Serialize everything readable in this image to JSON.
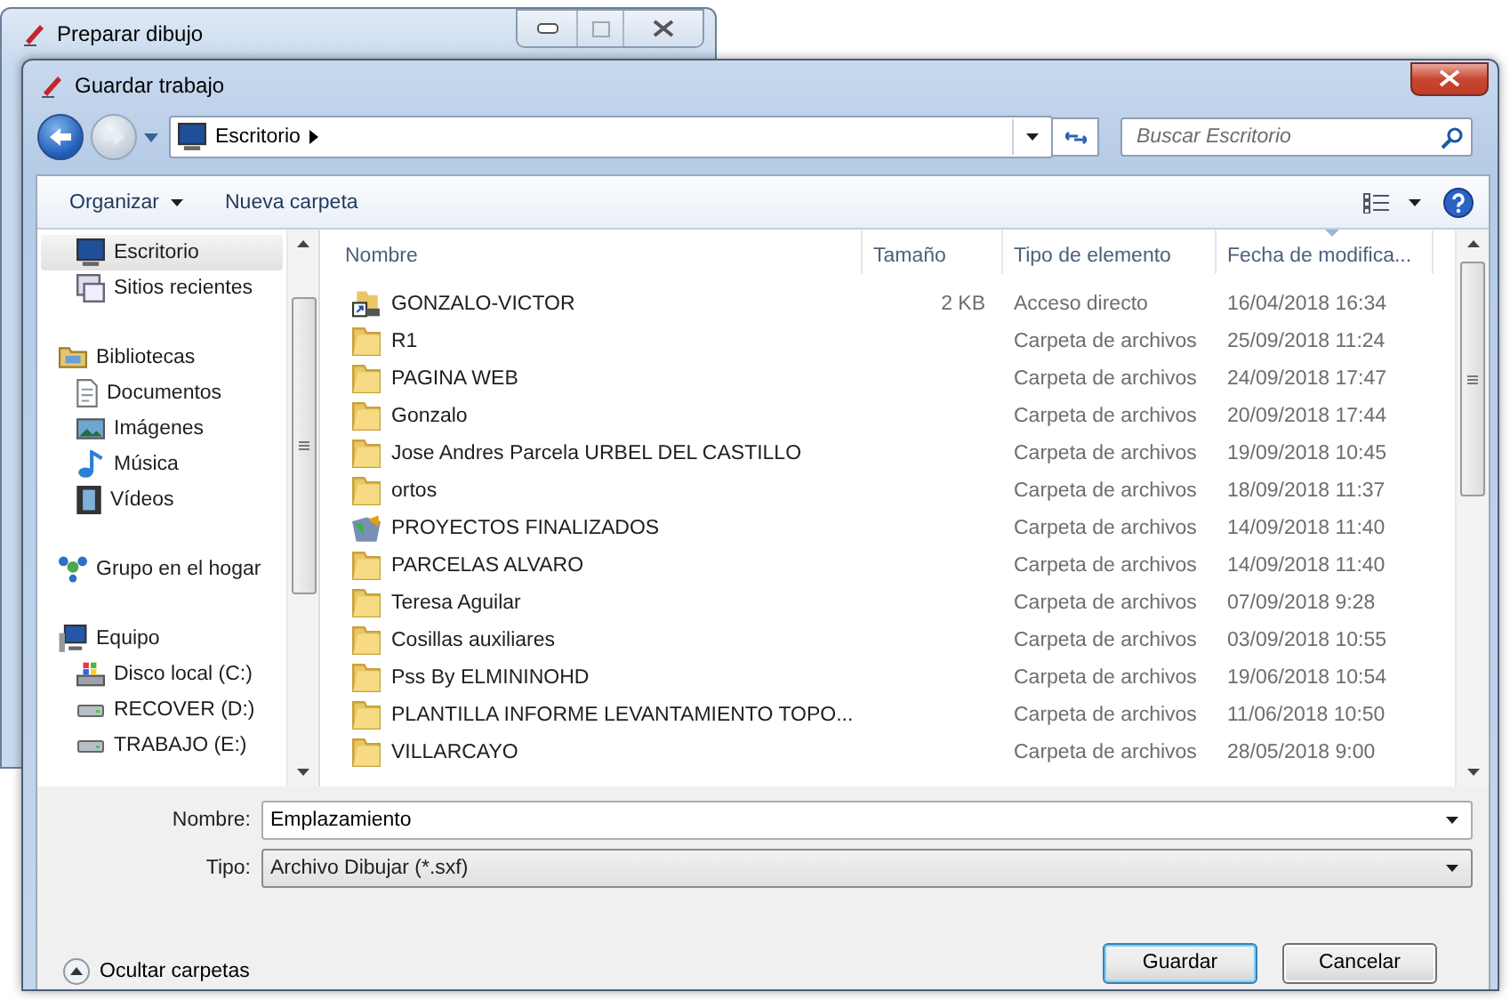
{
  "back_window": {
    "title": "Preparar dibujo"
  },
  "dialog": {
    "title": "Guardar trabajo"
  },
  "address": {
    "path": "Escritorio"
  },
  "search": {
    "placeholder": "Buscar Escritorio"
  },
  "toolbar": {
    "items": [
      {
        "label": "Organizar",
        "kind": "menu"
      },
      {
        "label": "Nueva carpeta",
        "kind": "button"
      }
    ]
  },
  "sidebar": {
    "items": [
      {
        "children": [
          {
            "label": "Escritorio",
            "kind": "desktop",
            "selected": true
          },
          {
            "label": "Sitios recientes",
            "kind": "recent",
            "selected": false
          }
        ]
      },
      {
        "label": "Bibliotecas",
        "kind": "library",
        "selected": false,
        "children": [
          {
            "label": "Documentos",
            "kind": "documents",
            "selected": false
          },
          {
            "label": "Imágenes",
            "kind": "pictures",
            "selected": false
          },
          {
            "label": "Música",
            "kind": "music",
            "selected": false
          },
          {
            "label": "Vídeos",
            "kind": "videos",
            "selected": false
          }
        ]
      },
      {
        "label": "Grupo en el hogar",
        "kind": "homegroup",
        "selected": false
      },
      {
        "label": "Equipo",
        "kind": "computer",
        "selected": false,
        "children": [
          {
            "label": "Disco local (C:)",
            "kind": "system_disk",
            "selected": false
          },
          {
            "label": "RECOVER (D:)",
            "kind": "drive",
            "selected": false
          },
          {
            "label": "TRABAJO (E:)",
            "kind": "drive",
            "selected": false
          }
        ]
      }
    ]
  },
  "table": {
    "columns": [
      {
        "label": "Nombre",
        "sorted": false
      },
      {
        "label": "Tamaño",
        "sorted": false
      },
      {
        "label": "Tipo de elemento",
        "sorted": false
      },
      {
        "label": "Fecha de modifica...",
        "sorted": true
      }
    ],
    "rows": [
      {
        "kind": "shortcut",
        "name": "GONZALO-VICTOR",
        "size": "2 KB",
        "type": "Acceso directo",
        "date": "16/04/2018 16:34"
      },
      {
        "kind": "folder",
        "name": "R1",
        "type": "Carpeta de archivos",
        "date": "25/09/2018 11:24"
      },
      {
        "kind": "folder",
        "name": "PAGINA WEB",
        "type": "Carpeta de archivos",
        "date": "24/09/2018 17:47"
      },
      {
        "kind": "folder",
        "name": "Gonzalo",
        "type": "Carpeta de archivos",
        "date": "20/09/2018 17:44"
      },
      {
        "kind": "folder",
        "name": "Jose Andres Parcela URBEL DEL CASTILLO",
        "type": "Carpeta de archivos",
        "date": "19/09/2018 10:45"
      },
      {
        "kind": "folder",
        "name": "ortos",
        "type": "Carpeta de archivos",
        "date": "18/09/2018 11:37"
      },
      {
        "kind": "special",
        "name": "PROYECTOS FINALIZADOS",
        "type": "Carpeta de archivos",
        "date": "14/09/2018 11:40"
      },
      {
        "kind": "folder",
        "name": "PARCELAS ALVARO",
        "type": "Carpeta de archivos",
        "date": "14/09/2018 11:40"
      },
      {
        "kind": "folder",
        "name": "Teresa Aguilar",
        "type": "Carpeta de archivos",
        "date": "07/09/2018 9:28"
      },
      {
        "kind": "folder",
        "name": "Cosillas auxiliares",
        "type": "Carpeta de archivos",
        "date": "03/09/2018 10:55"
      },
      {
        "kind": "folder",
        "name": "Pss By ELMININOHD",
        "type": "Carpeta de archivos",
        "date": "19/06/2018 10:54"
      },
      {
        "kind": "folder",
        "name": "PLANTILLA INFORME LEVANTAMIENTO TOPO...",
        "type": "Carpeta de archivos",
        "date": "11/06/2018 10:50"
      },
      {
        "kind": "folder",
        "name": "VILLARCAYO",
        "type": "Carpeta de archivos",
        "date": "28/05/2018 9:00"
      }
    ]
  },
  "form": {
    "fields": [
      {
        "label": "Nombre:",
        "value": "Emplazamiento",
        "kind": "combo_edit"
      },
      {
        "label": "Tipo:",
        "value": "Archivo Dibujar (*.sxf)",
        "kind": "combo_list"
      }
    ]
  },
  "hide_folders": {
    "label": "Ocultar carpetas"
  },
  "buttons": [
    {
      "label": "Guardar",
      "default": true
    },
    {
      "label": "Cancelar",
      "default": false
    }
  ]
}
